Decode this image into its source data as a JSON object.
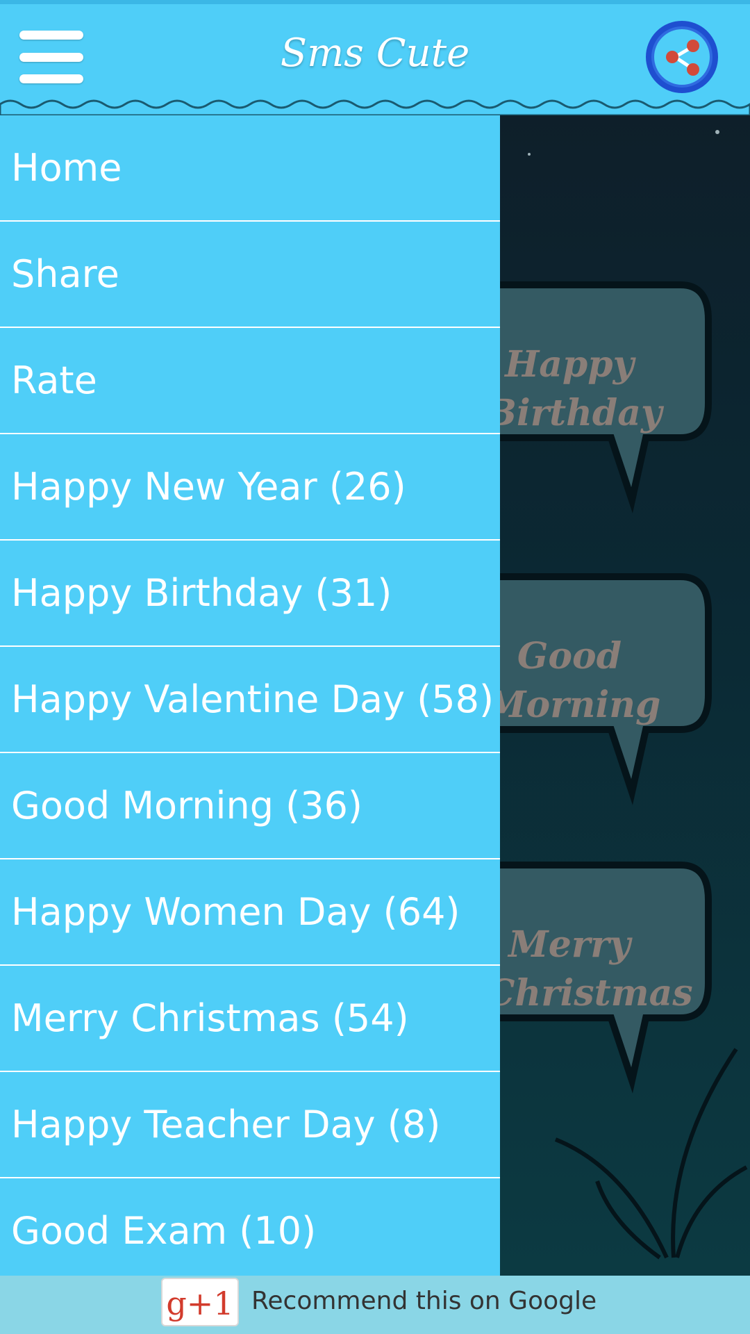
{
  "header": {
    "title": "Sms Cute",
    "menu_icon": "hamburger-menu-icon",
    "share_icon": "share-icon"
  },
  "drawer": {
    "items": [
      {
        "label": "Home"
      },
      {
        "label": "Share"
      },
      {
        "label": "Rate"
      },
      {
        "label": "Happy New Year (26)"
      },
      {
        "label": "Happy Birthday (31)"
      },
      {
        "label": "Happy Valentine Day (58)"
      },
      {
        "label": "Good Morning (36)"
      },
      {
        "label": "Happy Women Day (64)"
      },
      {
        "label": "Merry Christmas (54)"
      },
      {
        "label": "Happy Teacher Day (8)"
      },
      {
        "label": "Good Exam (10)"
      }
    ]
  },
  "background_cards": [
    {
      "line1": "Happy",
      "line2": "Birthday"
    },
    {
      "line1": "Good",
      "line2": "Morning"
    },
    {
      "line1": "Merry",
      "line2": "Christmas"
    }
  ],
  "ad": {
    "plus_one": "g+1",
    "text": "Recommend this on Google"
  },
  "colors": {
    "accent": "#4fcef8",
    "background": "#0c2a33",
    "ad_bar": "#8ad6e6"
  }
}
